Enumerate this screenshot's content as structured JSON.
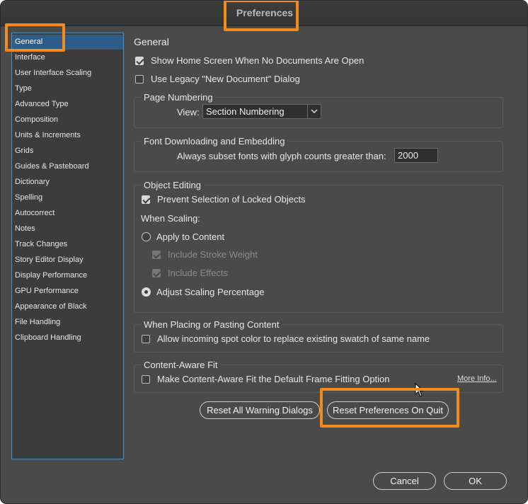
{
  "window": {
    "title": "Preferences"
  },
  "sidebar": {
    "items": [
      {
        "label": "General",
        "selected": true
      },
      {
        "label": "Interface"
      },
      {
        "label": "User Interface Scaling"
      },
      {
        "label": "Type"
      },
      {
        "label": "Advanced Type"
      },
      {
        "label": "Composition"
      },
      {
        "label": "Units & Increments"
      },
      {
        "label": "Grids"
      },
      {
        "label": "Guides & Pasteboard"
      },
      {
        "label": "Dictionary"
      },
      {
        "label": "Spelling"
      },
      {
        "label": "Autocorrect"
      },
      {
        "label": "Notes"
      },
      {
        "label": "Track Changes"
      },
      {
        "label": "Story Editor Display"
      },
      {
        "label": "Display Performance"
      },
      {
        "label": "GPU Performance"
      },
      {
        "label": "Appearance of Black"
      },
      {
        "label": "File Handling"
      },
      {
        "label": "Clipboard Handling"
      }
    ]
  },
  "general": {
    "title": "General",
    "show_home_screen": {
      "label": "Show Home Screen When No Documents Are Open",
      "checked": true
    },
    "legacy_new_doc": {
      "label": "Use Legacy \"New Document\" Dialog",
      "checked": false
    }
  },
  "page_numbering": {
    "title": "Page Numbering",
    "view_label": "View:",
    "view_value": "Section Numbering"
  },
  "font_downloading": {
    "title": "Font Downloading and Embedding",
    "subset_label": "Always subset fonts with glyph counts greater than:",
    "subset_value": "2000"
  },
  "object_editing": {
    "title": "Object Editing",
    "prevent_locked": {
      "label": "Prevent Selection of Locked Objects",
      "checked": true
    },
    "when_scaling": "When Scaling:",
    "apply_to_content": {
      "label": "Apply to Content",
      "selected": false
    },
    "include_stroke": {
      "label": "Include Stroke Weight",
      "checked": true,
      "disabled": true
    },
    "include_effects": {
      "label": "Include Effects",
      "checked": true,
      "disabled": true
    },
    "adjust_scaling": {
      "label": "Adjust Scaling Percentage",
      "selected": true
    }
  },
  "placing": {
    "title": "When Placing or Pasting Content",
    "spot_color": {
      "label": "Allow incoming spot color to replace existing swatch of same name",
      "checked": false
    }
  },
  "content_aware": {
    "title": "Content-Aware Fit",
    "default_option": {
      "label": "Make Content-Aware Fit the Default Frame Fitting Option",
      "checked": false
    },
    "more_info": "More Info..."
  },
  "buttons": {
    "reset_warnings": "Reset All Warning Dialogs",
    "reset_prefs": "Reset Preferences On Quit",
    "cancel": "Cancel",
    "ok": "OK"
  },
  "colors": {
    "highlight": "#f28a1c",
    "selection": "#2d5b8a",
    "background": "#4a4a4a"
  }
}
